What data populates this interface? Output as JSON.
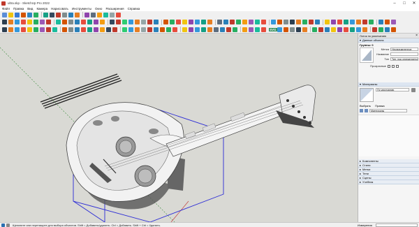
{
  "window": {
    "title": "ultra.skp - SketchUp Pro 2022",
    "controls": [
      "–",
      "□",
      "✕"
    ]
  },
  "menu": [
    "Файл",
    "Правка",
    "Вид",
    "Камера",
    "Нарисовать",
    "Инструменты",
    "Окно",
    "Расширения",
    "Справка"
  ],
  "toolbar": {
    "row1_colors": [
      "#5b8dd6",
      "#f1c40f",
      "#3a7bd5",
      "#d35400",
      "#2e86c1",
      "#27ae60",
      "#16a085",
      "#34495e",
      "#c0392b",
      "#7f8c8d",
      "#2980b9",
      "#e67e22",
      "#8e44ad",
      "#5d6d7e",
      "#f39c12",
      "#1abc9c",
      "#95a5a6",
      "#e74c3c"
    ],
    "row2_colors": [
      "#2c3e50",
      "#e67e22",
      "#3498db",
      "#e74c3c",
      "#f1c40f",
      "#27ae60",
      "#9b59b6",
      "#c0392b",
      "#1abc9c",
      "#d35400",
      "#7f8c8d",
      "#2980b9",
      "#e74c3c",
      "#16a085",
      "#8e44ad",
      "#f39c12",
      "#34495e",
      "#c0392b",
      "#2ecc71",
      "#3498db",
      "#e67e22",
      "#95a5a6",
      "#c0392b",
      "#2980b9",
      "#d35400",
      "#27ae60",
      "#e74c3c",
      "#f1c40f",
      "#8e44ad",
      "#3498db",
      "#16a085",
      "#e67e22",
      "#5d6d7e",
      "#2980b9",
      "#c0392b",
      "#27ae60",
      "#f39c12",
      "#9b59b6",
      "#1abc9c",
      "#e74c3c",
      "#3498db",
      "#d35400",
      "#7f8c8d",
      "#2c3e50",
      "#e67e22",
      "#27ae60",
      "#c0392b",
      "#2980b9",
      "#f1c40f",
      "#8e44ad",
      "#e74c3c",
      "#16a085",
      "#3498db",
      "#e67e22",
      "#c0392b",
      "#27ae60",
      "#2980b9",
      "#d35400",
      "#9b59b6"
    ],
    "svg_label": "SVG"
  },
  "tray": {
    "header": "Лоток по умолчанию",
    "entity_info": {
      "title": "Данные объекта",
      "selection": "Группы: 0",
      "layer_label": "Метка",
      "layer_value": "Неопределенное",
      "name_label": "Название",
      "type_label": "Тип",
      "type_value": "Тип: под определяется",
      "instances_label": "Прозрачные"
    },
    "materials": {
      "title": "Материалы",
      "current": "По умолчанию",
      "tab_select": "Выбрать",
      "tab_edit": "Правка",
      "library": "Материалы"
    },
    "collapsed_panels": [
      "Компоненты",
      "Стили",
      "Метки",
      "Тени",
      "Сцены",
      "Учебник"
    ]
  },
  "status": {
    "message": "Щелкните или перетащите для выбора объектов. Shift = Добавить/удалить. Ctrl = Добавить. Shift + Ctrl = Удалить.",
    "measure_label": "Измерения"
  }
}
